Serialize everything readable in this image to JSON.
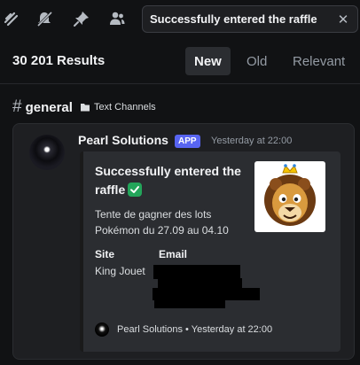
{
  "toolbar": {
    "icons": [
      "threads-icon",
      "mute-bell-icon",
      "pin-icon",
      "members-icon"
    ],
    "search_value": "Successfully entered the raffle",
    "clear_glyph": "✕"
  },
  "results": {
    "count_label": "30 201 Results",
    "sort_options": [
      "New",
      "Old",
      "Relevant"
    ],
    "active_sort": "New"
  },
  "channel": {
    "hash": "#",
    "name": "general",
    "category": "Text Channels"
  },
  "message": {
    "author": "Pearl Solutions",
    "badge": "APP",
    "timestamp": "Yesterday at 22:00",
    "embed": {
      "title": "Successfully entered the raffle",
      "description": "Tente de gagner des lots Pokémon du 27.09 au 04.10",
      "fields": [
        {
          "name": "Site",
          "value": "King Jouet"
        },
        {
          "name": "Email",
          "value": ""
        }
      ],
      "footer": "Pearl Solutions • Yesterday at 22:00",
      "thumbnail": "lion-mascot-icon",
      "color": "#1a1a1a"
    }
  },
  "colors": {
    "background": "#111214",
    "card": "#1e1f22",
    "embed": "#2b2d31",
    "badge": "#5865f2",
    "check": "#23a55a"
  }
}
